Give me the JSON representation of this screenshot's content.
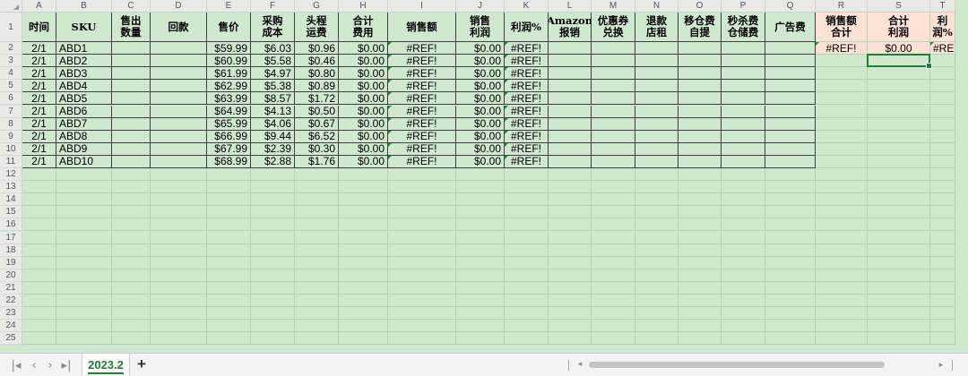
{
  "columns": [
    "A",
    "B",
    "C",
    "D",
    "E",
    "F",
    "G",
    "H",
    "I",
    "J",
    "K",
    "L",
    "M",
    "N",
    "O",
    "P",
    "Q",
    "R",
    "S",
    "T"
  ],
  "row_numbers": [
    1,
    2,
    3,
    4,
    5,
    6,
    7,
    8,
    9,
    10,
    11,
    12,
    13,
    14,
    15,
    16,
    17,
    18,
    19,
    20,
    21,
    22,
    23,
    24,
    25
  ],
  "headers": [
    "时间",
    "SKU",
    "售出\n数量",
    "回款",
    "售价",
    "采购\n成本",
    "头程\n运费",
    "合计\n费用",
    "销售额",
    "销售\n利润",
    "利润%",
    "Amazon\n报销",
    "优惠券\n兑换",
    "退款\n店租",
    "移仓费\n自提",
    "秒杀费\n仓储费",
    "广告费",
    "",
    "销售额\n合计",
    "合计\n利润",
    "利润%"
  ],
  "rows": [
    {
      "date": "2/1",
      "sku": "ABD1",
      "qty": "",
      "payback": "",
      "price": "$59.99",
      "cost": "$6.03",
      "freight": "$0.96",
      "total_fee": "$0.00",
      "sales": "#REF!",
      "profit": "$0.00",
      "profit_pct": "#REF!"
    },
    {
      "date": "2/1",
      "sku": "ABD2",
      "qty": "",
      "payback": "",
      "price": "$60.99",
      "cost": "$5.58",
      "freight": "$0.46",
      "total_fee": "$0.00",
      "sales": "#REF!",
      "profit": "$0.00",
      "profit_pct": "#REF!"
    },
    {
      "date": "2/1",
      "sku": "ABD3",
      "qty": "",
      "payback": "",
      "price": "$61.99",
      "cost": "$4.97",
      "freight": "$0.80",
      "total_fee": "$0.00",
      "sales": "#REF!",
      "profit": "$0.00",
      "profit_pct": "#REF!"
    },
    {
      "date": "2/1",
      "sku": "ABD4",
      "qty": "",
      "payback": "",
      "price": "$62.99",
      "cost": "$5.38",
      "freight": "$0.89",
      "total_fee": "$0.00",
      "sales": "#REF!",
      "profit": "$0.00",
      "profit_pct": "#REF!"
    },
    {
      "date": "2/1",
      "sku": "ABD5",
      "qty": "",
      "payback": "",
      "price": "$63.99",
      "cost": "$8.57",
      "freight": "$1.72",
      "total_fee": "$0.00",
      "sales": "#REF!",
      "profit": "$0.00",
      "profit_pct": "#REF!"
    },
    {
      "date": "2/1",
      "sku": "ABD6",
      "qty": "",
      "payback": "",
      "price": "$64.99",
      "cost": "$4.13",
      "freight": "$0.50",
      "total_fee": "$0.00",
      "sales": "#REF!",
      "profit": "$0.00",
      "profit_pct": "#REF!"
    },
    {
      "date": "2/1",
      "sku": "ABD7",
      "qty": "",
      "payback": "",
      "price": "$65.99",
      "cost": "$4.06",
      "freight": "$0.67",
      "total_fee": "$0.00",
      "sales": "#REF!",
      "profit": "$0.00",
      "profit_pct": "#REF!"
    },
    {
      "date": "2/1",
      "sku": "ABD8",
      "qty": "",
      "payback": "",
      "price": "$66.99",
      "cost": "$9.44",
      "freight": "$6.52",
      "total_fee": "$0.00",
      "sales": "#REF!",
      "profit": "$0.00",
      "profit_pct": "#REF!"
    },
    {
      "date": "2/1",
      "sku": "ABD9",
      "qty": "",
      "payback": "",
      "price": "$67.99",
      "cost": "$2.39",
      "freight": "$0.30",
      "total_fee": "$0.00",
      "sales": "#REF!",
      "profit": "$0.00",
      "profit_pct": "#REF!"
    },
    {
      "date": "2/1",
      "sku": "ABD10",
      "qty": "",
      "payback": "",
      "price": "$68.99",
      "cost": "$2.88",
      "freight": "$1.76",
      "total_fee": "$0.00",
      "sales": "#REF!",
      "profit": "$0.00",
      "profit_pct": "#REF!"
    }
  ],
  "summary": {
    "sales_total": "#REF!",
    "profit_total": "$0.00",
    "profit_pct": "#REF!"
  },
  "selected_cell": "S3",
  "sheet_tab": "2023.2",
  "nav": {
    "first": "|◂",
    "prev": "‹",
    "next": "›",
    "last": "▸|"
  },
  "add_sheet_label": "+",
  "scroll": {
    "left_arrow": "◂",
    "right_arrow": "▸"
  },
  "colors": {
    "sheet_bg": "#cfe8cf",
    "summary_bg": "#fce2d6",
    "accent": "#1e7e34"
  }
}
